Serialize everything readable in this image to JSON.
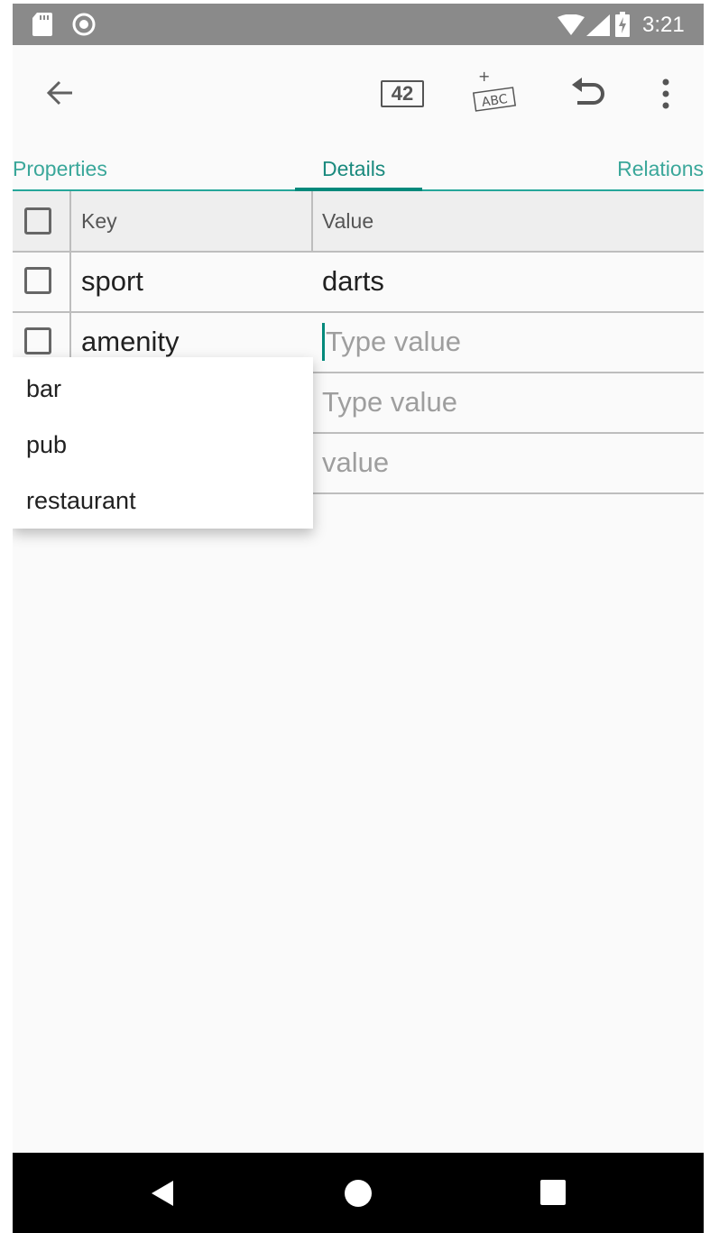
{
  "status_bar": {
    "time": "3:21",
    "icons": [
      "sd-card-icon",
      "record-icon",
      "wifi-icon",
      "signal-icon",
      "battery-charging-icon"
    ]
  },
  "toolbar": {
    "back_icon": "arrow-left-icon",
    "count_badge": "42",
    "add_text_icon": "abc-plus-icon",
    "add_text_mark": "+",
    "add_text_label": "ABC",
    "undo_icon": "undo-icon",
    "more_icon": "more-vertical-icon"
  },
  "tabs": [
    {
      "label": "Properties",
      "selected": false
    },
    {
      "label": "Details",
      "selected": true
    },
    {
      "label": "Relations",
      "selected": false
    }
  ],
  "table": {
    "header": {
      "key": "Key",
      "value": "Value"
    },
    "rows": [
      {
        "key": "sport",
        "value": "darts",
        "value_is_placeholder": false
      },
      {
        "key": "amenity",
        "value": "Type value",
        "value_is_placeholder": true
      },
      {
        "key": "",
        "value": "Type value",
        "value_is_placeholder": true
      },
      {
        "key": "",
        "value": "value",
        "value_is_placeholder": true
      }
    ]
  },
  "dropdown": {
    "items": [
      "bar",
      "pub",
      "restaurant"
    ]
  },
  "nav_bar": {
    "icons": [
      "back-triangle-icon",
      "home-circle-icon",
      "recents-square-icon"
    ]
  },
  "colors": {
    "accent": "#00897b",
    "tab_text": "#3aa79a",
    "status_bar": "#8a8a8a",
    "nav_bar": "#000000"
  }
}
